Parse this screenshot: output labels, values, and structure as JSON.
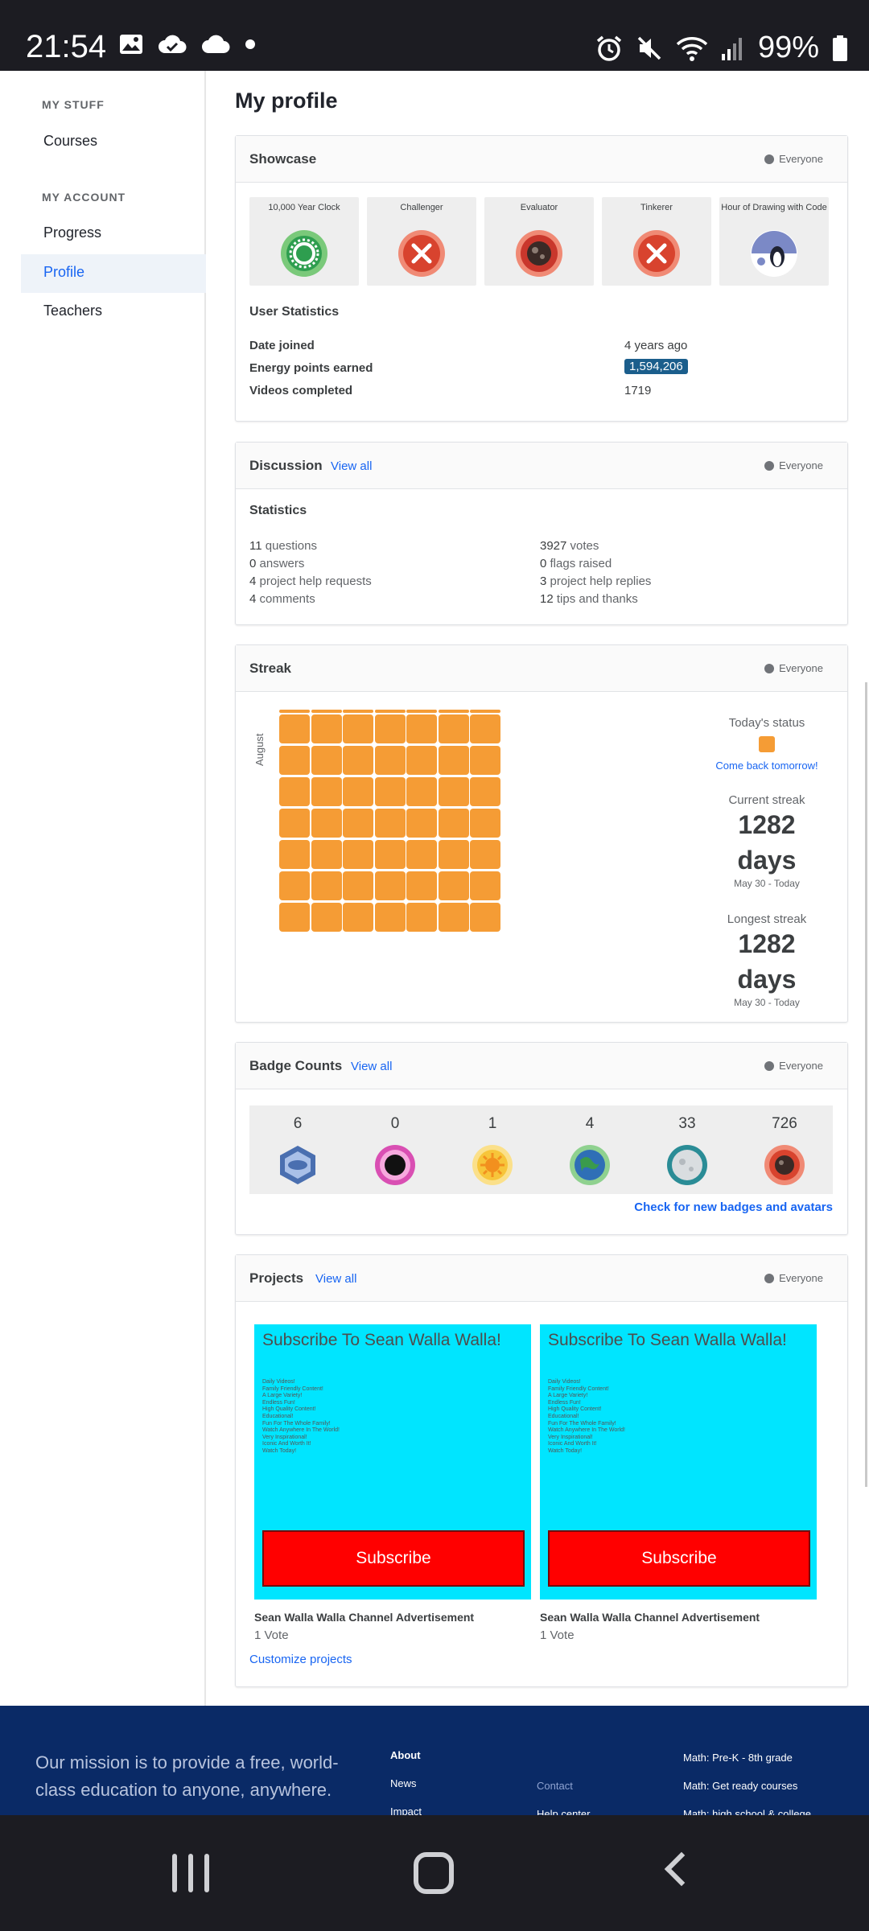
{
  "status_bar": {
    "time": "21:54",
    "battery": "99%"
  },
  "sidebar": {
    "my_stuff_label": "MY STUFF",
    "courses": "Courses",
    "my_account_label": "MY ACCOUNT",
    "progress": "Progress",
    "profile": "Profile",
    "teachers": "Teachers"
  },
  "page_title": "My profile",
  "visibility": "Everyone",
  "showcase": {
    "title": "Showcase",
    "badges": [
      {
        "name": "10,000 Year Clock",
        "color": "#2e9e4f"
      },
      {
        "name": "Challenger",
        "color": "#d8432e"
      },
      {
        "name": "Evaluator",
        "color": "#c9372c"
      },
      {
        "name": "Tinkerer",
        "color": "#d8432e"
      },
      {
        "name": "Hour of Drawing with Code",
        "color": "#7b89c6"
      }
    ],
    "user_statistics_title": "User Statistics",
    "stats": [
      {
        "label": "Date joined",
        "value": "4 years ago"
      },
      {
        "label": "Energy points earned",
        "value": "1,594,206"
      },
      {
        "label": "Videos completed",
        "value": "1719"
      }
    ]
  },
  "discussion": {
    "title": "Discussion",
    "view_all": "View all",
    "statistics_title": "Statistics",
    "left": [
      {
        "num": "11",
        "text": " questions"
      },
      {
        "num": "0",
        "text": " answers"
      },
      {
        "num": "4",
        "text": " project help requests"
      },
      {
        "num": "4",
        "text": " comments"
      }
    ],
    "right": [
      {
        "num": "3927",
        "text": " votes"
      },
      {
        "num": "0",
        "text": " flags raised"
      },
      {
        "num": "3",
        "text": " project help replies"
      },
      {
        "num": "12",
        "text": " tips and thanks"
      }
    ]
  },
  "streak": {
    "title": "Streak",
    "month_label": "August",
    "today_status_label": "Today's status",
    "come_back": "Come back tomorrow!",
    "current_label": "Current streak",
    "current_value": "1282",
    "current_unit": "days",
    "current_range": "May 30 - Today",
    "longest_label": "Longest streak",
    "longest_value": "1282",
    "longest_unit": "days",
    "longest_range": "May 30 - Today",
    "active_color": "#f59c35"
  },
  "badge_counts": {
    "title": "Badge Counts",
    "view_all": "View all",
    "counts": [
      {
        "count": "6",
        "icon": "challenge-patch-icon",
        "color": "#4a6fb0"
      },
      {
        "count": "0",
        "icon": "black-hole-icon",
        "color": "#d94fb3"
      },
      {
        "count": "1",
        "icon": "sun-icon",
        "color": "#f2b01e"
      },
      {
        "count": "4",
        "icon": "earth-icon",
        "color": "#3a9b4c"
      },
      {
        "count": "33",
        "icon": "moon-icon",
        "color": "#2a8c96"
      },
      {
        "count": "726",
        "icon": "meteorite-icon",
        "color": "#d8432e"
      }
    ],
    "check_link": "Check for new badges and avatars"
  },
  "projects": {
    "title": "Projects",
    "view_all": "View all",
    "items": [
      {
        "thumb_heading": "Subscribe To Sean Walla Walla!",
        "thumb_lines": "Daily Videos!\nFamily Friendly Content!\nA Large Variety!\nEndless Fun!\nHigh Quality Content!\nEducational!\nFun For The Whole Family!\nWatch Anywhere In The World!\nVery Inspirational!\nIconic And Worth It!\nWatch Today!",
        "button": "Subscribe",
        "title": "Sean Walla Walla Channel Advertisement",
        "votes": "1 Vote"
      },
      {
        "thumb_heading": "Subscribe To Sean Walla Walla!",
        "thumb_lines": "Daily Videos!\nFamily Friendly Content!\nA Large Variety!\nEndless Fun!\nHigh Quality Content!\nEducational!\nFun For The Whole Family!\nWatch Anywhere In The World!\nVery Inspirational!\nIconic And Worth It!\nWatch Today!",
        "button": "Subscribe",
        "title": "Sean Walla Walla Channel Advertisement",
        "votes": "1 Vote"
      }
    ],
    "customize": "Customize projects"
  },
  "footer": {
    "mission": "Our mission is to provide a free, world-class education to anyone, anywhere.",
    "about": "About",
    "news": "News",
    "impact": "Impact",
    "contact": "Contact",
    "help_center": "Help center",
    "math1": "Math: Pre-K - 8th grade",
    "math2": "Math: Get ready courses",
    "math3": "Math: high school & college"
  }
}
